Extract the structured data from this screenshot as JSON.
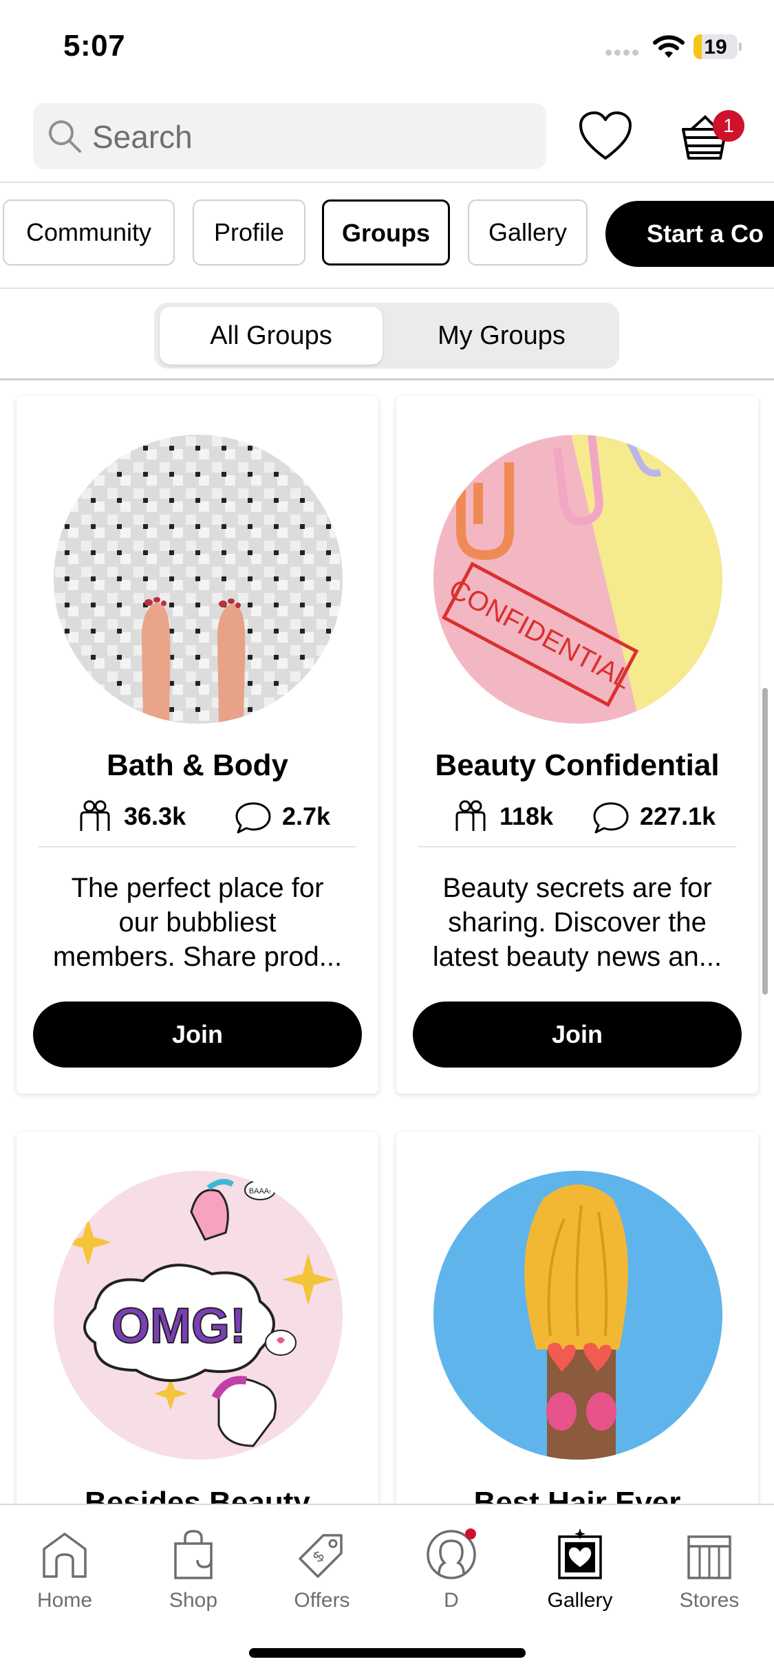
{
  "status_bar": {
    "time": "5:07",
    "battery": "19",
    "battery_level": 0.19
  },
  "header": {
    "search_placeholder": "Search",
    "cart_count": "1"
  },
  "tabs": [
    {
      "label": "Community",
      "active": false
    },
    {
      "label": "Profile",
      "active": false
    },
    {
      "label": "Groups",
      "active": true
    },
    {
      "label": "Gallery",
      "active": false
    }
  ],
  "start_button": "Start a Co",
  "segment": {
    "options": [
      "All Groups",
      "My Groups"
    ],
    "selected": "All Groups"
  },
  "groups": [
    {
      "title": "Bath & Body",
      "members": "36.3k",
      "comments": "2.7k",
      "desc": [
        "The perfect place for",
        "our bubbliest",
        "members. Share prod..."
      ],
      "button": "Join"
    },
    {
      "title": "Beauty Confidential",
      "members": "118k",
      "comments": "227.1k",
      "desc": [
        "Beauty secrets are for",
        "sharing. Discover the",
        "latest beauty news an..."
      ],
      "button": "Join"
    },
    {
      "title": "Besides Beauty",
      "stamp": "OMG!",
      "stamp2": "BAAA!"
    },
    {
      "title": "Best Hair Ever"
    },
    {
      "stamp": "CONFIDENTIAL"
    }
  ],
  "nav": [
    {
      "label": "Home",
      "icon": "home-icon"
    },
    {
      "label": "Shop",
      "icon": "shop-bag-icon"
    },
    {
      "label": "Offers",
      "icon": "tag-icon"
    },
    {
      "label": "D",
      "icon": "profile-icon"
    },
    {
      "label": "Gallery",
      "icon": "gallery-icon",
      "active": true
    },
    {
      "label": "Stores",
      "icon": "store-icon"
    }
  ]
}
